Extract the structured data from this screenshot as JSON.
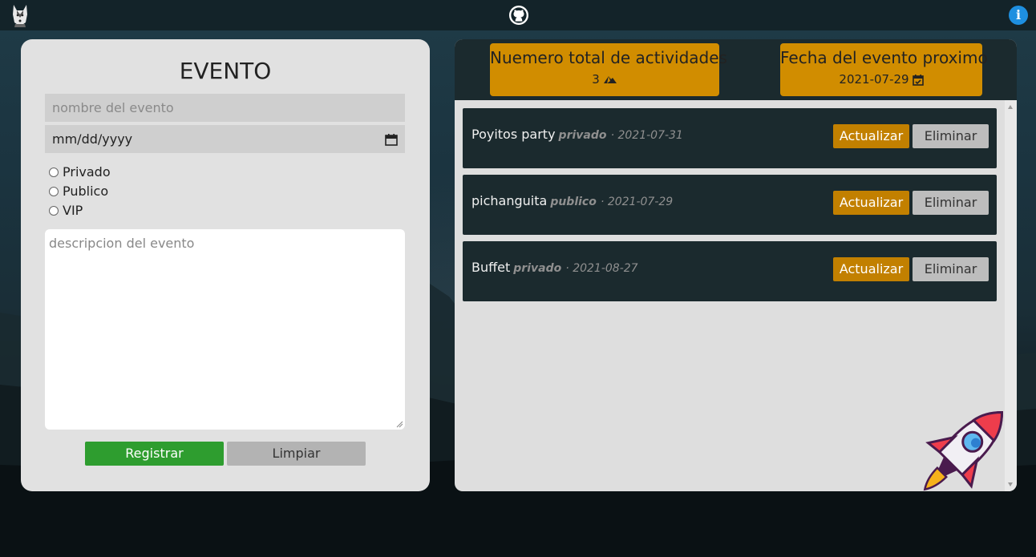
{
  "topbar": {
    "logo_icon": "husky-logo-icon",
    "github_icon": "github-icon",
    "info_icon": "info-icon",
    "info_glyph": "i"
  },
  "form": {
    "title": "EVENTO",
    "name_placeholder": "nombre del evento",
    "date_placeholder": "mm/dd/yyyy",
    "radio_options": [
      "Privado",
      "Publico",
      "VIP"
    ],
    "description_placeholder": "descripcion del evento",
    "register_label": "Registrar",
    "clear_label": "Limpiar"
  },
  "stats": {
    "total_label": "Nuemero total de actividades",
    "total_value": "3",
    "next_label": "Fecha del evento proximo",
    "next_value": "2021-07-29"
  },
  "events": [
    {
      "name": "Poyitos party",
      "type": "privado",
      "date": "· 2021-07-31"
    },
    {
      "name": "pichanguita",
      "type": "publico",
      "date": "· 2021-07-29"
    },
    {
      "name": "Buffet",
      "type": "privado",
      "date": "· 2021-08-27"
    }
  ],
  "event_buttons": {
    "update_label": "Actualizar",
    "delete_label": "Eliminar"
  },
  "colors": {
    "accent_orange": "#d18d00",
    "update_button": "#c28000",
    "register_green": "#2e9d2f",
    "dark_panel": "#1b2a2e",
    "info_blue": "#1e8fe0"
  }
}
